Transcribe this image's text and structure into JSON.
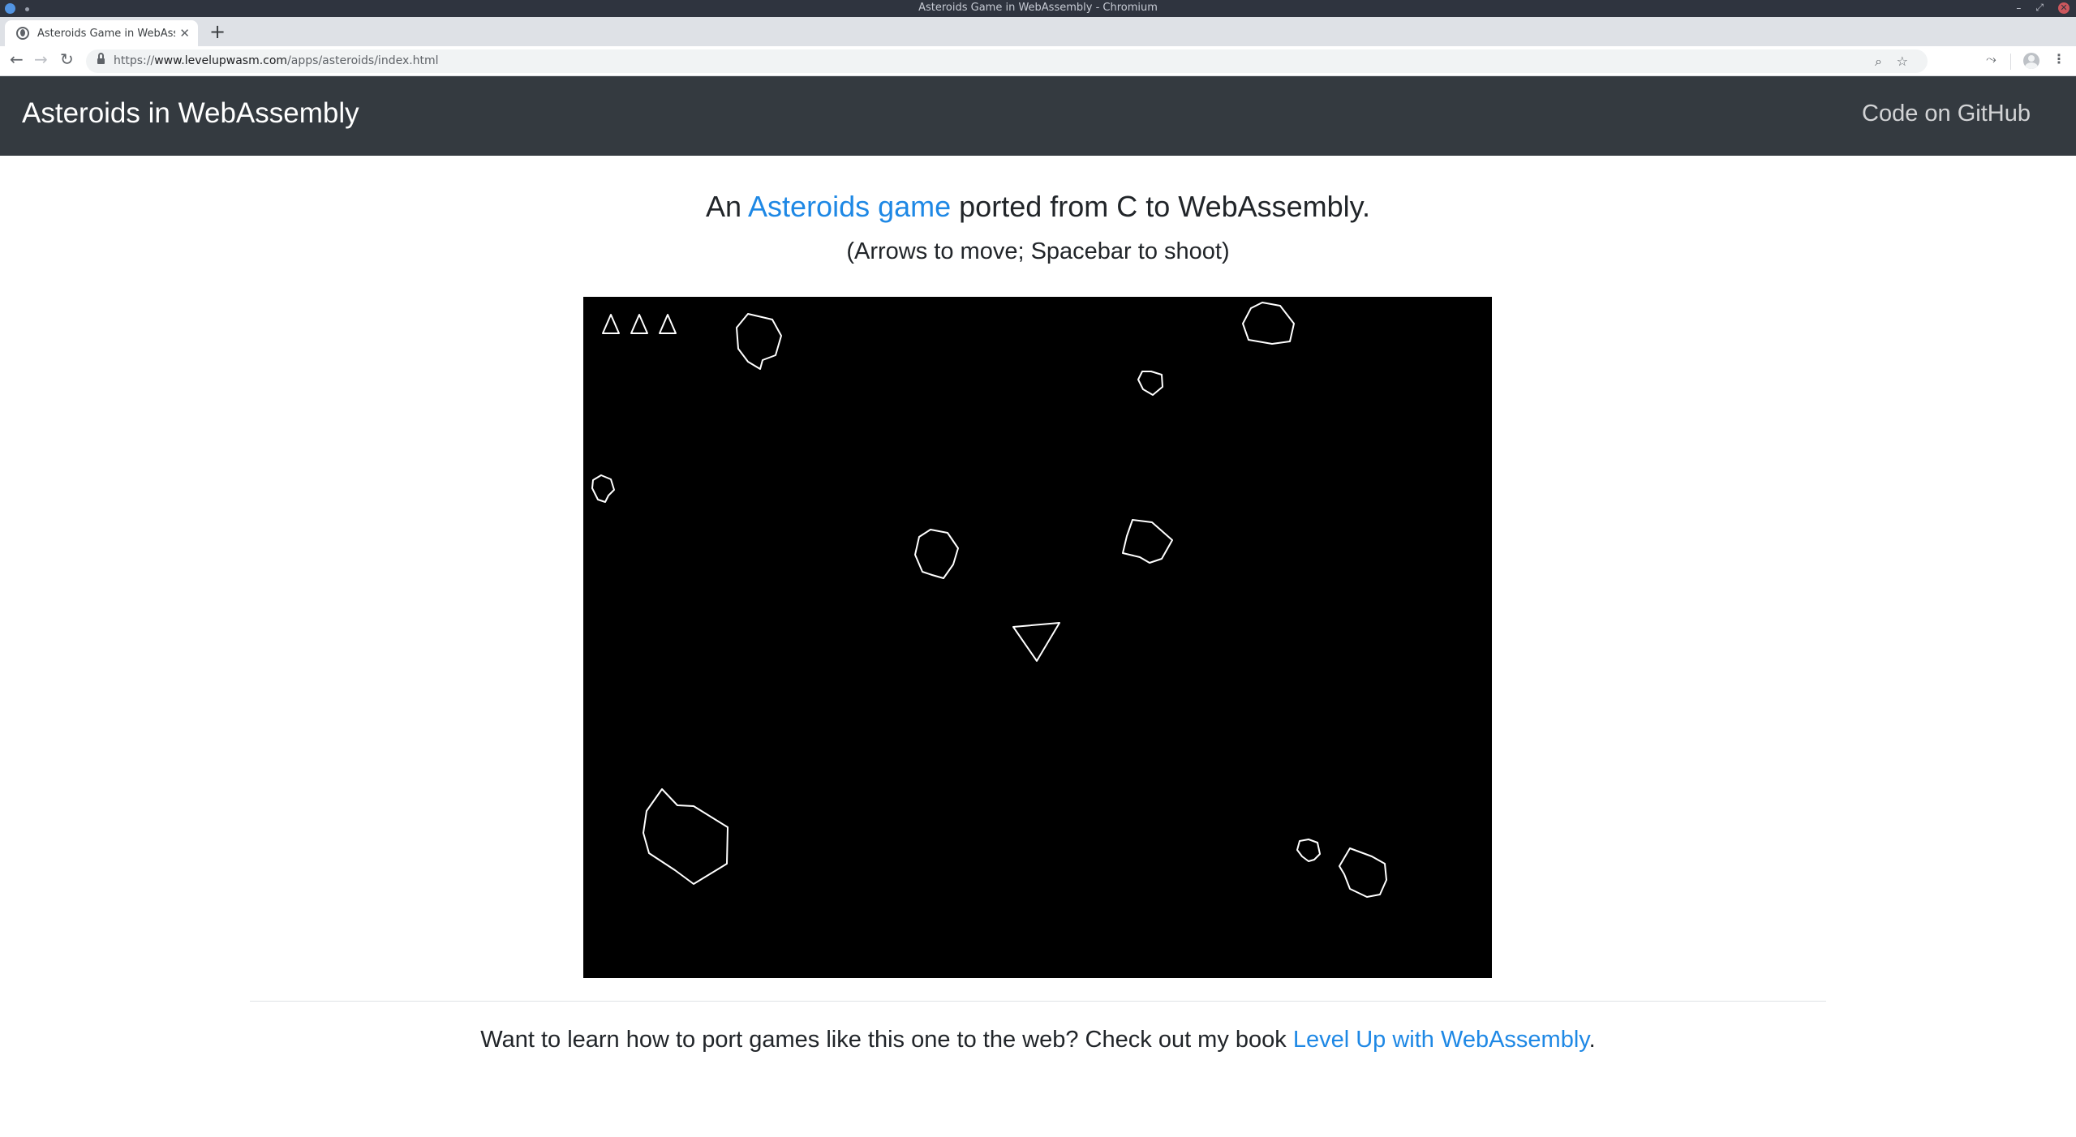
{
  "window": {
    "title": "Asteroids Game in WebAssembly - Chromium",
    "controls": {
      "minimize": "–",
      "maximize": "⤢",
      "close": "✕"
    }
  },
  "tabs": [
    {
      "title": "Asteroids Game in WebAsse",
      "close": "✕",
      "favicon": "globe-icon"
    }
  ],
  "new_tab_label": "+",
  "toolbar": {
    "back": "←",
    "forward": "→",
    "reload": "↻",
    "url_scheme": "https://",
    "url_host": "www.levelupwasm.com",
    "url_path": "/apps/asteroids/index.html",
    "zoom": "⌕",
    "star": "☆",
    "extensions": "⤳",
    "menu": "⋮"
  },
  "navbar": {
    "brand": "Asteroids in WebAssembly",
    "github": "Code on GitHub"
  },
  "lead": {
    "prefix": "An ",
    "link": "Asteroids game",
    "suffix": " ported from C to WebAssembly."
  },
  "instructions": "(Arrows to move; Spacebar to shoot)",
  "game": {
    "background": "#000000",
    "stroke": "#ffffff",
    "lives": 3
  },
  "footer": {
    "prefix": "Want to learn how to port games like this one to the web? Check out my book ",
    "link": "Level Up with WebAssembly",
    "suffix": "."
  },
  "colors": {
    "navbar": "#343a40",
    "link": "#1e88e5",
    "text": "#212529"
  }
}
